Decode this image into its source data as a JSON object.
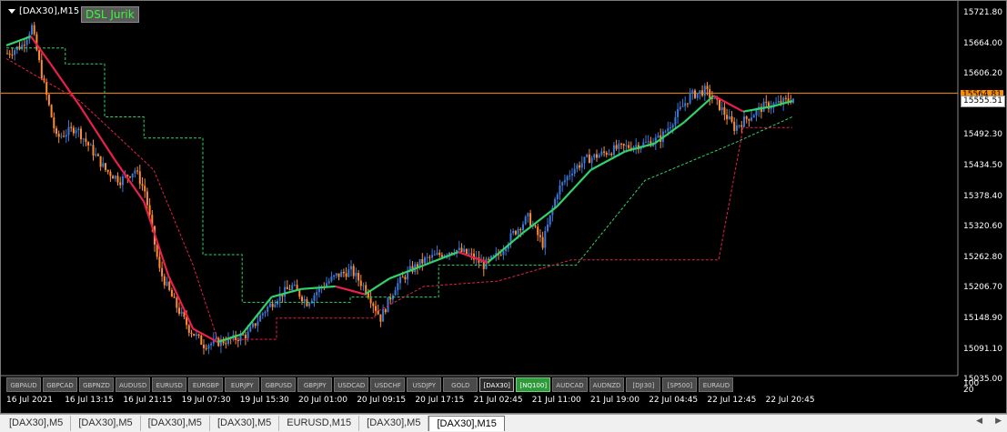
{
  "window": {
    "symbol_label": "[DAX30],M15",
    "indicator_label": "DSL Jurik"
  },
  "price_axis": {
    "labels": [
      "15721.80",
      "15664.00",
      "15606.20",
      "15549.40",
      "15492.30",
      "15434.50",
      "15378.40",
      "15320.60",
      "15262.80",
      "15206.70",
      "15148.90",
      "15091.10",
      "15035.00"
    ],
    "bid_tag": "15564.81",
    "last_tag": "15555.51",
    "lower_label_1": "100",
    "lower_label_2": "20"
  },
  "time_axis": {
    "labels": [
      "16 Jul 2021",
      "16 Jul 13:15",
      "16 Jul 21:15",
      "19 Jul 07:30",
      "19 Jul 15:30",
      "20 Jul 01:00",
      "20 Jul 09:15",
      "20 Jul 17:15",
      "21 Jul 02:45",
      "21 Jul 11:00",
      "21 Jul 19:00",
      "22 Jul 04:45",
      "22 Jul 12:45",
      "22 Jul 20:45"
    ]
  },
  "symbol_buttons": [
    {
      "label": "GBPAUD",
      "state": "normal"
    },
    {
      "label": "GBPCAD",
      "state": "normal"
    },
    {
      "label": "GBPNZD",
      "state": "normal"
    },
    {
      "label": "AUDUSD",
      "state": "normal"
    },
    {
      "label": "EURUSD",
      "state": "normal"
    },
    {
      "label": "EURGBP",
      "state": "normal"
    },
    {
      "label": "EURJPY",
      "state": "normal"
    },
    {
      "label": "GBPUSD",
      "state": "normal"
    },
    {
      "label": "GBPJPY",
      "state": "normal"
    },
    {
      "label": "USDCAD",
      "state": "normal"
    },
    {
      "label": "USDCHF",
      "state": "normal"
    },
    {
      "label": "USDJPY",
      "state": "normal"
    },
    {
      "label": "GOLD",
      "state": "normal"
    },
    {
      "label": "[DAX30]",
      "state": "active"
    },
    {
      "label": "[NQ100]",
      "state": "highlight"
    },
    {
      "label": "AUDCAD",
      "state": "normal"
    },
    {
      "label": "AUDNZD",
      "state": "normal"
    },
    {
      "label": "[DJI30]",
      "state": "normal"
    },
    {
      "label": "[SP500]",
      "state": "normal"
    },
    {
      "label": "EURAUD",
      "state": "normal"
    }
  ],
  "tabs": [
    {
      "label": "[DAX30],M5",
      "active": false
    },
    {
      "label": "[DAX30],M5",
      "active": false
    },
    {
      "label": "[DAX30],M5",
      "active": false
    },
    {
      "label": "[DAX30],M5",
      "active": false
    },
    {
      "label": "EURUSD,M15",
      "active": false
    },
    {
      "label": "[DAX30],M5",
      "active": false
    },
    {
      "label": "[DAX30],M15",
      "active": true
    }
  ],
  "chart_data": {
    "type": "line",
    "symbol": "[DAX30]",
    "timeframe": "M15",
    "ylim": [
      15035.0,
      15721.8
    ],
    "colors": {
      "bull_candle": "#3a78d8",
      "bear_candle": "#ff8c30",
      "dsl_up": "#32d26a",
      "dsl_down": "#e8204a",
      "upper_band": "#32d26a",
      "lower_band": "#e8204a",
      "bid_line": "#ff8c00"
    },
    "bid_price": 15564.81,
    "last_price": 15555.51,
    "close_path": [
      [
        0,
        15640
      ],
      [
        6,
        15655
      ],
      [
        10,
        15690
      ],
      [
        14,
        15600
      ],
      [
        20,
        15480
      ],
      [
        28,
        15500
      ],
      [
        34,
        15460
      ],
      [
        40,
        15420
      ],
      [
        46,
        15400
      ],
      [
        52,
        15420
      ],
      [
        56,
        15380
      ],
      [
        62,
        15230
      ],
      [
        68,
        15170
      ],
      [
        74,
        15120
      ],
      [
        80,
        15090
      ],
      [
        86,
        15095
      ],
      [
        92,
        15100
      ],
      [
        98,
        15110
      ],
      [
        104,
        15150
      ],
      [
        110,
        15180
      ],
      [
        116,
        15200
      ],
      [
        122,
        15170
      ],
      [
        128,
        15200
      ],
      [
        134,
        15220
      ],
      [
        140,
        15230
      ],
      [
        146,
        15195
      ],
      [
        152,
        15140
      ],
      [
        158,
        15200
      ],
      [
        164,
        15230
      ],
      [
        170,
        15250
      ],
      [
        176,
        15260
      ],
      [
        182,
        15270
      ],
      [
        188,
        15260
      ],
      [
        194,
        15240
      ],
      [
        200,
        15260
      ],
      [
        206,
        15300
      ],
      [
        212,
        15330
      ],
      [
        218,
        15280
      ],
      [
        224,
        15380
      ],
      [
        230,
        15420
      ],
      [
        236,
        15440
      ],
      [
        242,
        15450
      ],
      [
        248,
        15460
      ],
      [
        254,
        15465
      ],
      [
        260,
        15470
      ],
      [
        266,
        15480
      ],
      [
        272,
        15520
      ],
      [
        278,
        15560
      ],
      [
        284,
        15570
      ],
      [
        290,
        15540
      ],
      [
        296,
        15500
      ],
      [
        302,
        15520
      ],
      [
        308,
        15540
      ],
      [
        314,
        15545
      ],
      [
        320,
        15555
      ]
    ],
    "dsl_line": [
      [
        0,
        15655
      ],
      [
        10,
        15672
      ],
      [
        18,
        15620
      ],
      [
        30,
        15540
      ],
      [
        44,
        15440
      ],
      [
        56,
        15360
      ],
      [
        66,
        15220
      ],
      [
        76,
        15120
      ],
      [
        86,
        15095
      ],
      [
        96,
        15110
      ],
      [
        108,
        15180
      ],
      [
        120,
        15195
      ],
      [
        134,
        15200
      ],
      [
        146,
        15185
      ],
      [
        156,
        15215
      ],
      [
        170,
        15240
      ],
      [
        184,
        15265
      ],
      [
        196,
        15245
      ],
      [
        210,
        15300
      ],
      [
        224,
        15350
      ],
      [
        238,
        15420
      ],
      [
        252,
        15455
      ],
      [
        264,
        15470
      ],
      [
        276,
        15510
      ],
      [
        288,
        15560
      ],
      [
        300,
        15530
      ],
      [
        312,
        15540
      ],
      [
        320,
        15550
      ]
    ],
    "upper_band": [
      [
        0,
        15650
      ],
      [
        24,
        15650
      ],
      [
        24,
        15620
      ],
      [
        40,
        15620
      ],
      [
        40,
        15520
      ],
      [
        56,
        15520
      ],
      [
        56,
        15480
      ],
      [
        80,
        15480
      ],
      [
        80,
        15260
      ],
      [
        96,
        15260
      ],
      [
        96,
        15170
      ],
      [
        140,
        15170
      ],
      [
        140,
        15180
      ],
      [
        176,
        15180
      ],
      [
        176,
        15240
      ],
      [
        232,
        15240
      ],
      [
        260,
        15400
      ],
      [
        296,
        15470
      ],
      [
        320,
        15520
      ]
    ],
    "lower_band": [
      [
        0,
        15630
      ],
      [
        30,
        15550
      ],
      [
        60,
        15420
      ],
      [
        76,
        15240
      ],
      [
        86,
        15100
      ],
      [
        110,
        15100
      ],
      [
        110,
        15140
      ],
      [
        150,
        15140
      ],
      [
        150,
        15150
      ],
      [
        170,
        15200
      ],
      [
        200,
        15210
      ],
      [
        230,
        15250
      ],
      [
        290,
        15250
      ],
      [
        300,
        15500
      ],
      [
        320,
        15500
      ]
    ]
  }
}
